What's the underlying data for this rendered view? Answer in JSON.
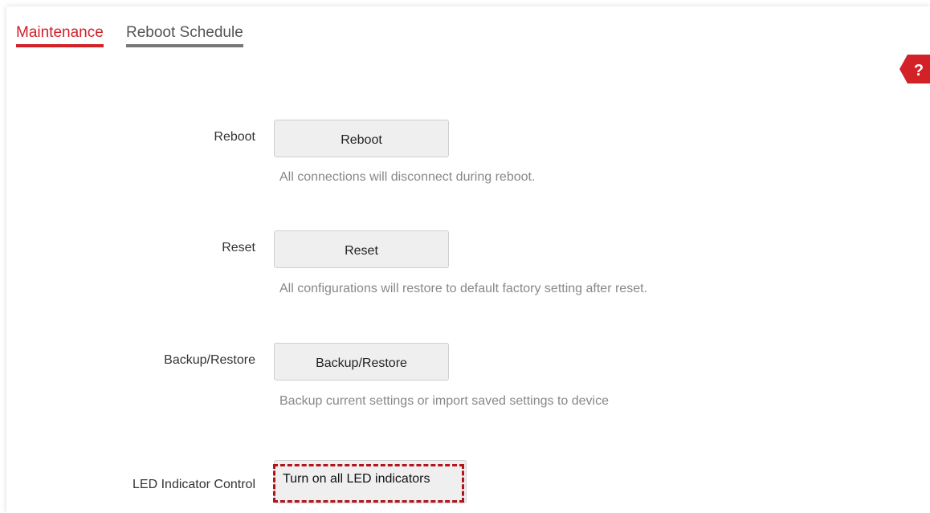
{
  "tabs": [
    {
      "label": "Maintenance",
      "active": true
    },
    {
      "label": "Reboot Schedule",
      "active": false
    }
  ],
  "help": {
    "symbol": "?",
    "icon": "help-icon",
    "color": "#d32128"
  },
  "sections": {
    "reboot": {
      "label": "Reboot",
      "button": "Reboot",
      "hint": "All connections will disconnect during reboot."
    },
    "reset": {
      "label": "Reset",
      "button": "Reset",
      "hint": "All configurations will restore to default factory setting after reset."
    },
    "backup": {
      "label": "Backup/Restore",
      "button": "Backup/Restore",
      "hint": "Backup current settings or import saved settings to device"
    },
    "led": {
      "label": "LED Indicator Control",
      "button": "Turn on all LED indicators",
      "highlight_color": "#b3141b"
    }
  },
  "colors": {
    "accent": "#d32128",
    "hint_text": "#888888",
    "button_bg": "#efefef"
  }
}
